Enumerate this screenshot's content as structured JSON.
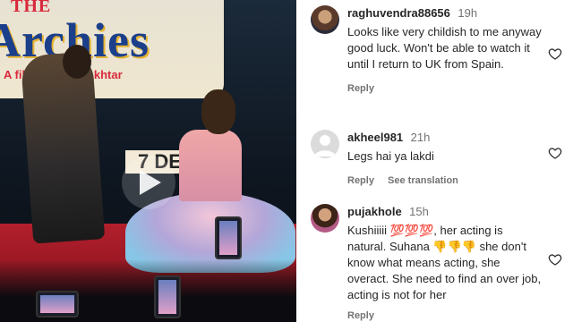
{
  "video": {
    "poster_title_small": "THE",
    "poster_title": "Archies",
    "poster_subtitle": "A film by Zoya Akhtar",
    "poster_date": "7 DE",
    "play_icon": "play-icon"
  },
  "comments": [
    {
      "username": "raghuvendra88656",
      "time": "19h",
      "text": "Looks like very childish to me anyway good luck. Won't be able to watch it until I return to UK from Spain.",
      "reply": "Reply",
      "heart_icon": "heart-icon"
    },
    {
      "username": "akheel981",
      "time": "21h",
      "text": "Legs hai ya lakdi",
      "reply": "Reply",
      "translate": "See translation",
      "heart_icon": "heart-icon"
    },
    {
      "username": "pujakhole",
      "time": "15h",
      "text_part1": "Kushiiiii ",
      "emoji1": "💯💯💯",
      "text_part2": ", her acting is natural. Suhana ",
      "emoji2": "👎👎👎",
      "text_part3": " she don't know what means acting, she overact. She need to find an over job, acting is not for her",
      "reply": "Reply",
      "heart_icon": "heart-icon"
    }
  ]
}
